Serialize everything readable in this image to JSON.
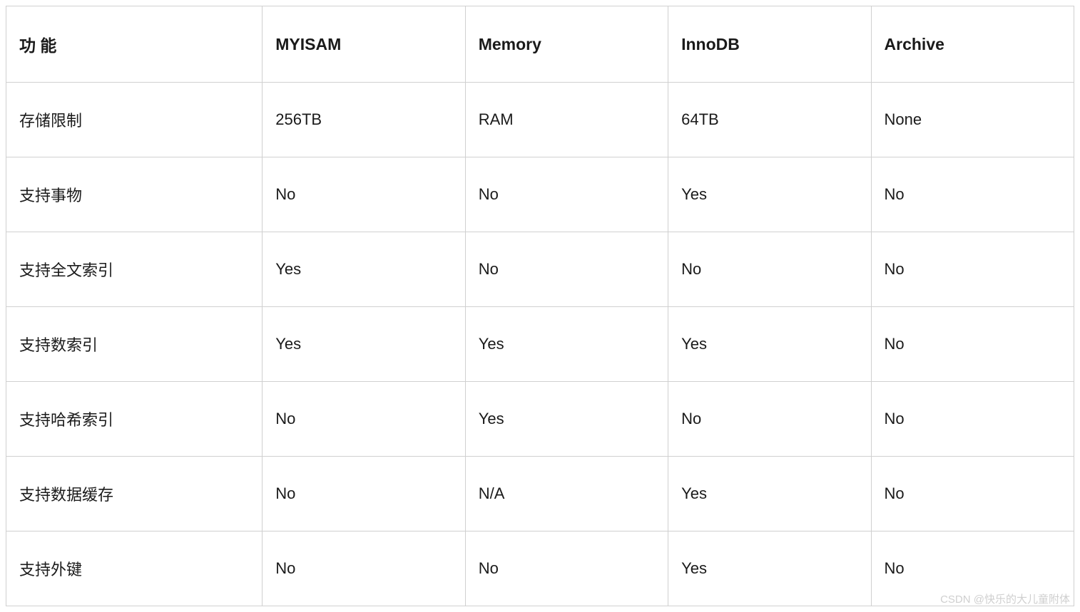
{
  "chart_data": {
    "type": "table",
    "headers": [
      "功 能",
      "MYISAM",
      "Memory",
      "InnoDB",
      "Archive"
    ],
    "rows": [
      [
        "存储限制",
        "256TB",
        "RAM",
        "64TB",
        "None"
      ],
      [
        "支持事物",
        "No",
        "No",
        "Yes",
        "No"
      ],
      [
        "支持全文索引",
        "Yes",
        "No",
        "No",
        "No"
      ],
      [
        "支持数索引",
        "Yes",
        "Yes",
        "Yes",
        "No"
      ],
      [
        "支持哈希索引",
        "No",
        "Yes",
        "No",
        "No"
      ],
      [
        "支持数据缓存",
        "No",
        "N/A",
        "Yes",
        "No"
      ],
      [
        "支持外键",
        "No",
        "No",
        "Yes",
        "No"
      ]
    ]
  },
  "watermark": "CSDN @快乐的大儿童附体"
}
